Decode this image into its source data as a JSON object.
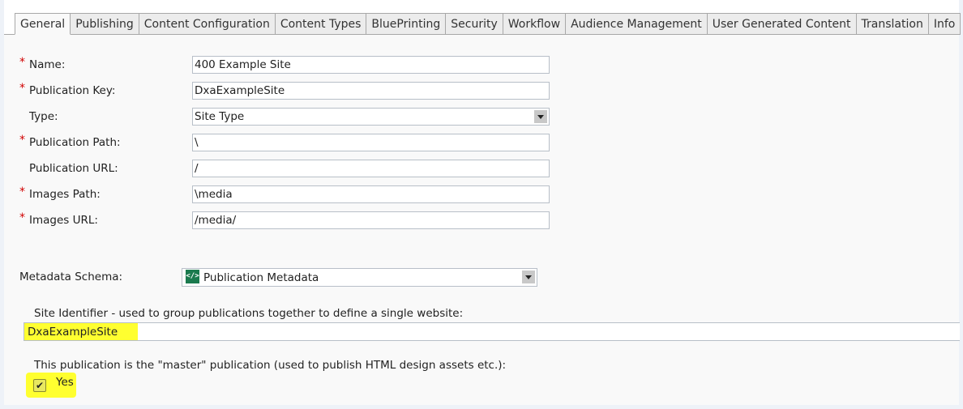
{
  "tabs": [
    {
      "label": "General",
      "active": true
    },
    {
      "label": "Publishing"
    },
    {
      "label": "Content Configuration"
    },
    {
      "label": "Content Types"
    },
    {
      "label": "BluePrinting"
    },
    {
      "label": "Security"
    },
    {
      "label": "Workflow"
    },
    {
      "label": "Audience Management"
    },
    {
      "label": "User Generated Content"
    },
    {
      "label": "Translation"
    },
    {
      "label": "Info"
    }
  ],
  "form": {
    "required_marker": "*",
    "fields": [
      {
        "label": "Name:",
        "required": true,
        "value": "400 Example Site",
        "type": "text"
      },
      {
        "label": "Publication Key:",
        "required": true,
        "value": "DxaExampleSite",
        "type": "text"
      },
      {
        "label": "Type:",
        "required": false,
        "value": "Site Type",
        "type": "select"
      },
      {
        "label": "Publication Path:",
        "required": true,
        "value": "\\",
        "type": "text"
      },
      {
        "label": "Publication URL:",
        "required": false,
        "value": "/",
        "type": "text"
      },
      {
        "label": "Images Path:",
        "required": true,
        "value": "\\media",
        "type": "text"
      },
      {
        "label": "Images URL:",
        "required": true,
        "value": "/media/",
        "type": "text"
      }
    ]
  },
  "metadata": {
    "label": "Metadata Schema:",
    "value": "Publication Metadata",
    "icon": "schema-icon",
    "icon_glyph": "</>"
  },
  "site_identifier": {
    "label": "Site Identifier - used to group publications together to define a single website:",
    "value": "DxaExampleSite"
  },
  "master": {
    "label": "This publication is the \"master\" publication (used to publish HTML design assets etc.):",
    "option_label": "Yes",
    "checked": true,
    "check_glyph": "✔"
  },
  "colors": {
    "required": "#d00000",
    "highlight": "#ffff30",
    "schema_icon": "#1b7a4e"
  }
}
